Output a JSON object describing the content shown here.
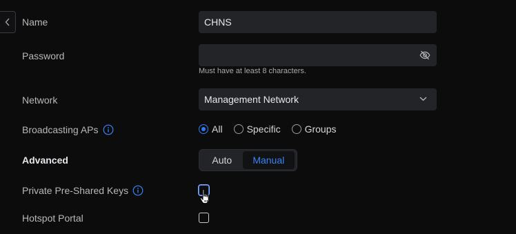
{
  "back_icon": "chevron-left-icon",
  "fields": {
    "name": {
      "label": "Name",
      "value": "CHNS"
    },
    "password": {
      "label": "Password",
      "value": "",
      "hint": "Must have at least 8 characters.",
      "toggle_icon": "eye-off-icon"
    },
    "network": {
      "label": "Network",
      "value": "Management Network",
      "dropdown_icon": "chevron-down-icon"
    },
    "broadcasting": {
      "label": "Broadcasting APs",
      "info_icon": "info-icon",
      "options": [
        "All",
        "Specific",
        "Groups"
      ],
      "selected": "All"
    },
    "advanced": {
      "label": "Advanced",
      "options": [
        "Auto",
        "Manual"
      ],
      "selected": "Manual"
    },
    "ppsk": {
      "label": "Private Pre-Shared Keys",
      "info_icon": "info-icon",
      "checked": false
    },
    "hotspot": {
      "label": "Hotspot Portal",
      "checked": false
    }
  },
  "colors": {
    "background": "#0c0c0d",
    "field": "#232427",
    "accent": "#2f7bf5",
    "label": "#b8b9bd"
  },
  "cursor_icon": "hand-pointer-icon"
}
